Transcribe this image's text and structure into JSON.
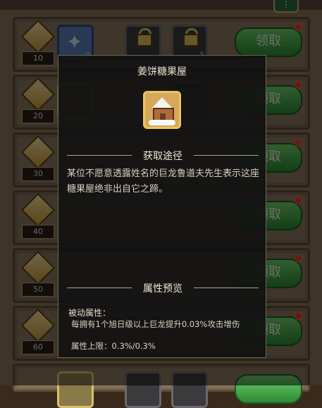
{
  "top_tab": {
    "icon": "dots-icon"
  },
  "rows": [
    {
      "level": "10",
      "claim_label": "领取"
    },
    {
      "level": "20",
      "claim_label": "领取"
    },
    {
      "level": "30",
      "claim_label": "领取"
    },
    {
      "level": "40",
      "claim_label": "领取"
    },
    {
      "level": "50",
      "claim_label": "领取"
    },
    {
      "level": "60",
      "claim_label": "领取"
    }
  ],
  "slot_counts": {
    "row1_slot1": "0",
    "row1_slot3": "5"
  },
  "popup": {
    "title": "姜饼糖果屋",
    "source_heading": "获取途径",
    "source_desc": "某位不愿意透露姓名的巨龙鲁道夫先生表示这座糖果屋绝非出自它之蹄。",
    "preview_heading": "属性预览",
    "passive_label": "被动属性：",
    "passive_text": "每拥有1个旭日级以上巨龙提升0.03%攻击增伤",
    "limit_text": "属性上限：0.3%/0.3%"
  },
  "colors": {
    "claim_green": "#3a9b3e",
    "badge_red": "#e23a2a",
    "gold_border": "#e8c75a"
  }
}
